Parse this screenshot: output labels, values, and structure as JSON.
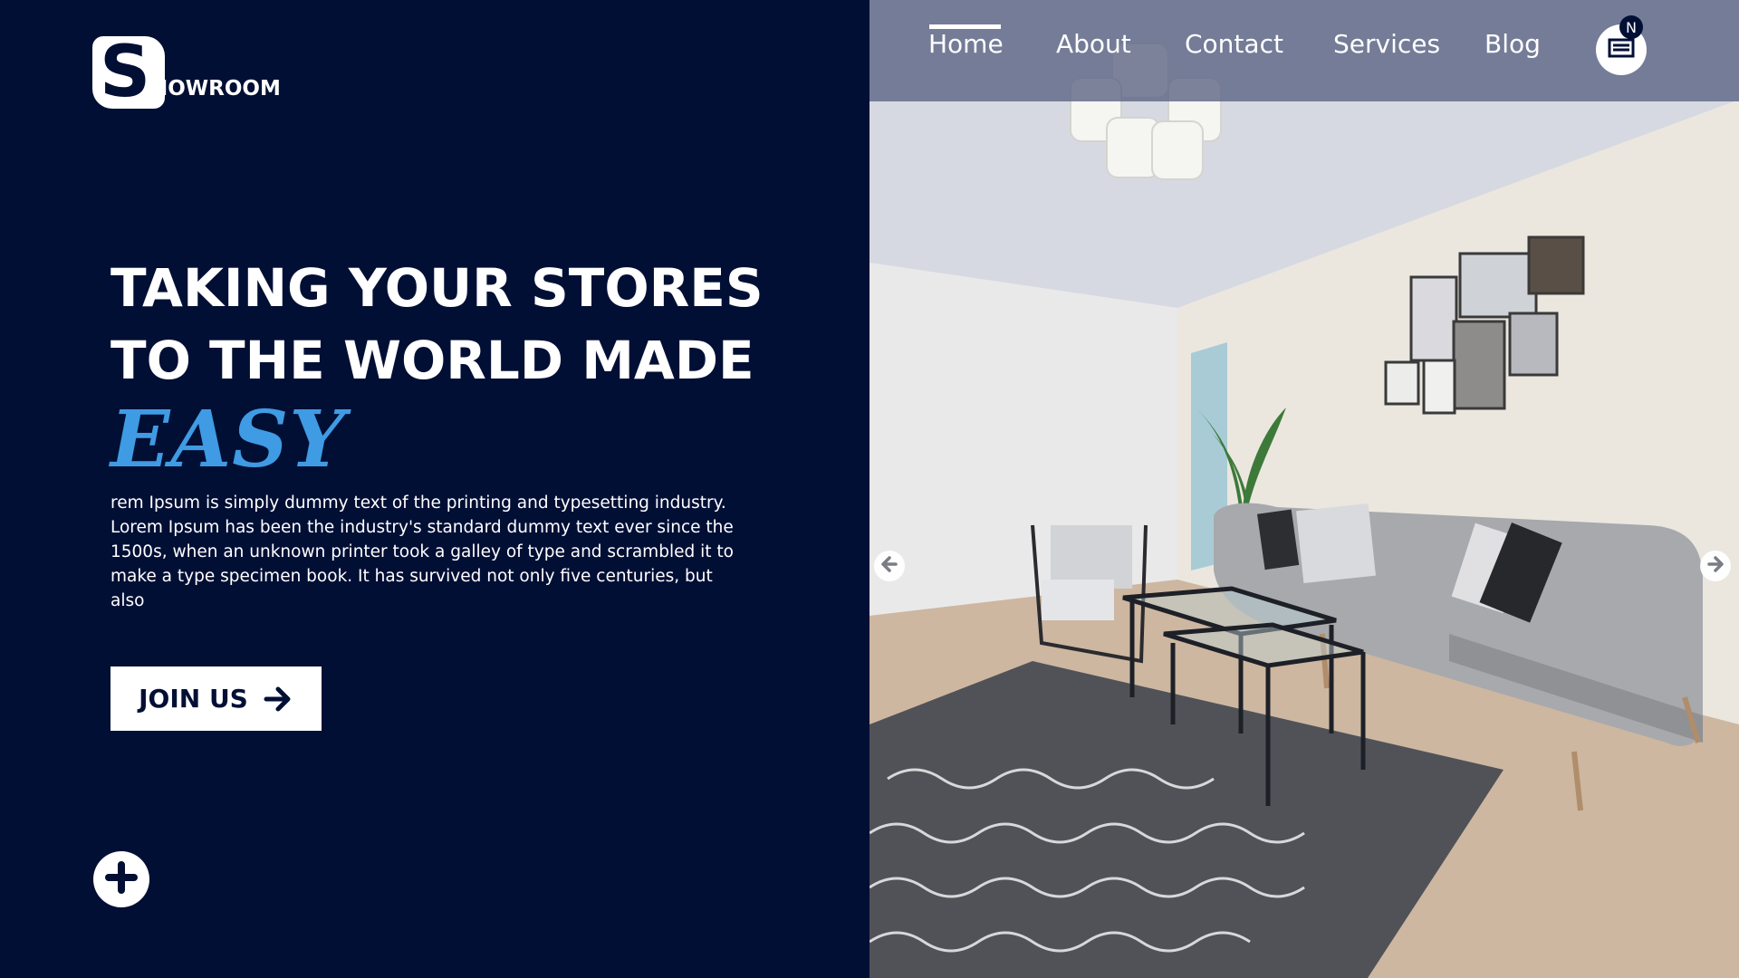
{
  "brand": {
    "logo_letter": "S",
    "logo_text": "HOWROOM"
  },
  "hero": {
    "headline_line1": "TAKING YOUR STORES",
    "headline_line2": "TO THE WORLD MADE",
    "highlight": "EASY",
    "paragraph": "rem Ipsum is simply dummy text of the printing and typesetting industry. Lorem Ipsum has been the industry's standard dummy text ever since the 1500s, when an unknown printer took a galley of type and scrambled it to make a type specimen book. It has survived not only five centuries, but also",
    "cta_label": "JOIN US"
  },
  "nav": {
    "items": [
      {
        "label": "Home",
        "active": true
      },
      {
        "label": "About",
        "active": false
      },
      {
        "label": "Contact",
        "active": false
      },
      {
        "label": "Services",
        "active": false
      },
      {
        "label": "Blog",
        "active": false
      }
    ],
    "cart_badge": "N"
  },
  "icons": {
    "cta": "arrow-right-icon",
    "add": "plus-icon",
    "cart": "cart-icon",
    "prev": "arrow-left-icon",
    "next": "arrow-right-icon"
  },
  "colors": {
    "background": "#020f35",
    "accent": "#3f9be3",
    "white": "#ffffff",
    "nav_overlay": "#586282"
  }
}
